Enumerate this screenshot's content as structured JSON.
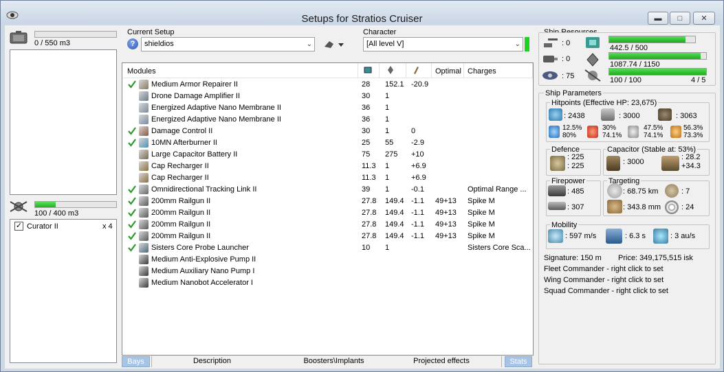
{
  "window": {
    "title": "Setups for Stratios Cruiser"
  },
  "cargo": {
    "label": "0 / 550 m3",
    "fill": 0
  },
  "drones": {
    "label": "100 / 400 m3",
    "fill": 0.25,
    "items": [
      {
        "name": "Curator II",
        "count": "x 4",
        "checked": true
      }
    ]
  },
  "current_setup": {
    "label": "Current Setup",
    "value": "shieldios"
  },
  "character": {
    "label": "Character",
    "value": "[All level V]"
  },
  "modules": {
    "headers": {
      "name": "Modules",
      "optimal": "Optimal",
      "charges": "Charges"
    },
    "rows": [
      {
        "active": true,
        "name": "Medium Armor Repairer II",
        "cpu": "28",
        "pg": "152.1",
        "cap": "-20.9",
        "optimal": "",
        "charges": "",
        "icon": "armor-repairer-icon",
        "color": "#8a7a60"
      },
      {
        "active": false,
        "name": "Drone Damage Amplifier II",
        "cpu": "30",
        "pg": "1",
        "cap": "",
        "optimal": "",
        "charges": "",
        "icon": "drone-amp-icon",
        "color": "#6d7a8a"
      },
      {
        "active": false,
        "name": "Energized Adaptive Nano Membrane II",
        "cpu": "36",
        "pg": "1",
        "cap": "",
        "optimal": "",
        "charges": "",
        "icon": "membrane-icon",
        "color": "#7a8aa0"
      },
      {
        "active": false,
        "name": "Energized Adaptive Nano Membrane II",
        "cpu": "36",
        "pg": "1",
        "cap": "",
        "optimal": "",
        "charges": "",
        "icon": "membrane-icon",
        "color": "#7a8aa0"
      },
      {
        "active": true,
        "name": "Damage Control II",
        "cpu": "30",
        "pg": "1",
        "cap": "0",
        "optimal": "",
        "charges": "",
        "icon": "damage-control-icon",
        "color": "#8a5a40"
      },
      {
        "active": true,
        "name": "10MN Afterburner II",
        "cpu": "25",
        "pg": "55",
        "cap": "-2.9",
        "optimal": "",
        "charges": "",
        "icon": "afterburner-icon",
        "color": "#4f8fb0"
      },
      {
        "active": false,
        "name": "Large Capacitor Battery II",
        "cpu": "75",
        "pg": "275",
        "cap": "+10",
        "optimal": "",
        "charges": "",
        "icon": "cap-battery-icon",
        "color": "#7a6a50"
      },
      {
        "active": false,
        "name": "Cap Recharger II",
        "cpu": "11.3",
        "pg": "1",
        "cap": "+6.9",
        "optimal": "",
        "charges": "",
        "icon": "cap-recharger-icon",
        "color": "#8a7040"
      },
      {
        "active": false,
        "name": "Cap Recharger II",
        "cpu": "11.3",
        "pg": "1",
        "cap": "+6.9",
        "optimal": "",
        "charges": "",
        "icon": "cap-recharger-icon",
        "color": "#8a7040"
      },
      {
        "active": true,
        "name": "Omnidirectional Tracking Link II",
        "cpu": "39",
        "pg": "1",
        "cap": "-0.1",
        "optimal": "",
        "charges": "Optimal Range ...",
        "icon": "tracking-link-icon",
        "color": "#6a6a6a"
      },
      {
        "active": true,
        "name": "200mm Railgun II",
        "cpu": "27.8",
        "pg": "149.4",
        "cap": "-1.1",
        "optimal": "49+13",
        "charges": "Spike M",
        "icon": "railgun-icon",
        "color": "#5a5a5a"
      },
      {
        "active": true,
        "name": "200mm Railgun II",
        "cpu": "27.8",
        "pg": "149.4",
        "cap": "-1.1",
        "optimal": "49+13",
        "charges": "Spike M",
        "icon": "railgun-icon",
        "color": "#5a5a5a"
      },
      {
        "active": true,
        "name": "200mm Railgun II",
        "cpu": "27.8",
        "pg": "149.4",
        "cap": "-1.1",
        "optimal": "49+13",
        "charges": "Spike M",
        "icon": "railgun-icon",
        "color": "#5a5a5a"
      },
      {
        "active": true,
        "name": "200mm Railgun II",
        "cpu": "27.8",
        "pg": "149.4",
        "cap": "-1.1",
        "optimal": "49+13",
        "charges": "Spike M",
        "icon": "railgun-icon",
        "color": "#5a5a5a"
      },
      {
        "active": true,
        "name": "Sisters Core Probe Launcher",
        "cpu": "10",
        "pg": "1",
        "cap": "",
        "optimal": "",
        "charges": "Sisters Core Sca...",
        "icon": "probe-launcher-icon",
        "color": "#4a6a7a"
      },
      {
        "active": false,
        "name": "Medium Anti-Explosive Pump II",
        "cpu": "",
        "pg": "",
        "cap": "",
        "optimal": "",
        "charges": "",
        "icon": "rig-icon",
        "color": "#3a3a3a"
      },
      {
        "active": false,
        "name": "Medium Auxiliary Nano Pump I",
        "cpu": "",
        "pg": "",
        "cap": "",
        "optimal": "",
        "charges": "",
        "icon": "rig-icon",
        "color": "#3a3a3a"
      },
      {
        "active": false,
        "name": "Medium Nanobot Accelerator I",
        "cpu": "",
        "pg": "",
        "cap": "",
        "optimal": "",
        "charges": "",
        "icon": "rig-icon",
        "color": "#3a3a3a"
      }
    ]
  },
  "tabs": {
    "bays": "Bays",
    "description": "Description",
    "boosters": "Boosters\\Implants",
    "projected": "Projected effects",
    "stats": "Stats"
  },
  "ship_resources": {
    "label": "Ship Resources",
    "turret": ": 0",
    "launcher": ": 0",
    "calibration": ": 75",
    "cpu": {
      "text": "442.5 / 500",
      "fill": 0.885
    },
    "powergrid": {
      "text": "1087.74 / 1150",
      "fill": 0.946
    },
    "drone_bw": {
      "text": "100 / 100",
      "fill": 1.0,
      "count": "4 / 5"
    }
  },
  "ship_parameters": {
    "label": "Ship Parameters",
    "hitpoints": {
      "label": "Hitpoints (Effective HP: 23,675)",
      "shield": ": 2438",
      "armor": ": 3000",
      "structure": ": 3063",
      "em": [
        "12.5%",
        "80%"
      ],
      "thermal": [
        "30%",
        "74.1%"
      ],
      "kinetic": [
        "47.5%",
        "74.1%"
      ],
      "explosive": [
        "56.3%",
        "73.3%"
      ]
    },
    "defence": {
      "label": "Defence",
      "v1": ": 225",
      "v2": ": 225"
    },
    "capacitor": {
      "label": "Capacitor (Stable at: 53%)",
      "capacity": ": 3000",
      "v1": ": 28.2",
      "v2": "+34.3"
    },
    "firepower": {
      "label": "Firepower",
      "volley": ": 485",
      "dps": ": 307"
    },
    "targeting": {
      "label": "Targeting",
      "range": ": 68.75 km",
      "targets": ": 7",
      "scan_res": ": 343.8 mm",
      "sensor": ": 24"
    },
    "mobility": {
      "label": "Mobility",
      "velocity": ": 597 m/s",
      "align": ": 6.3 s",
      "warp": ": 3 au/s"
    },
    "signature": "Signature: 150 m",
    "price": "Price: 349,175,515 isk",
    "fleet": "Fleet Commander - right click to set",
    "wing": "Wing Commander - right click to set",
    "squad": "Squad Commander - right click to set"
  }
}
